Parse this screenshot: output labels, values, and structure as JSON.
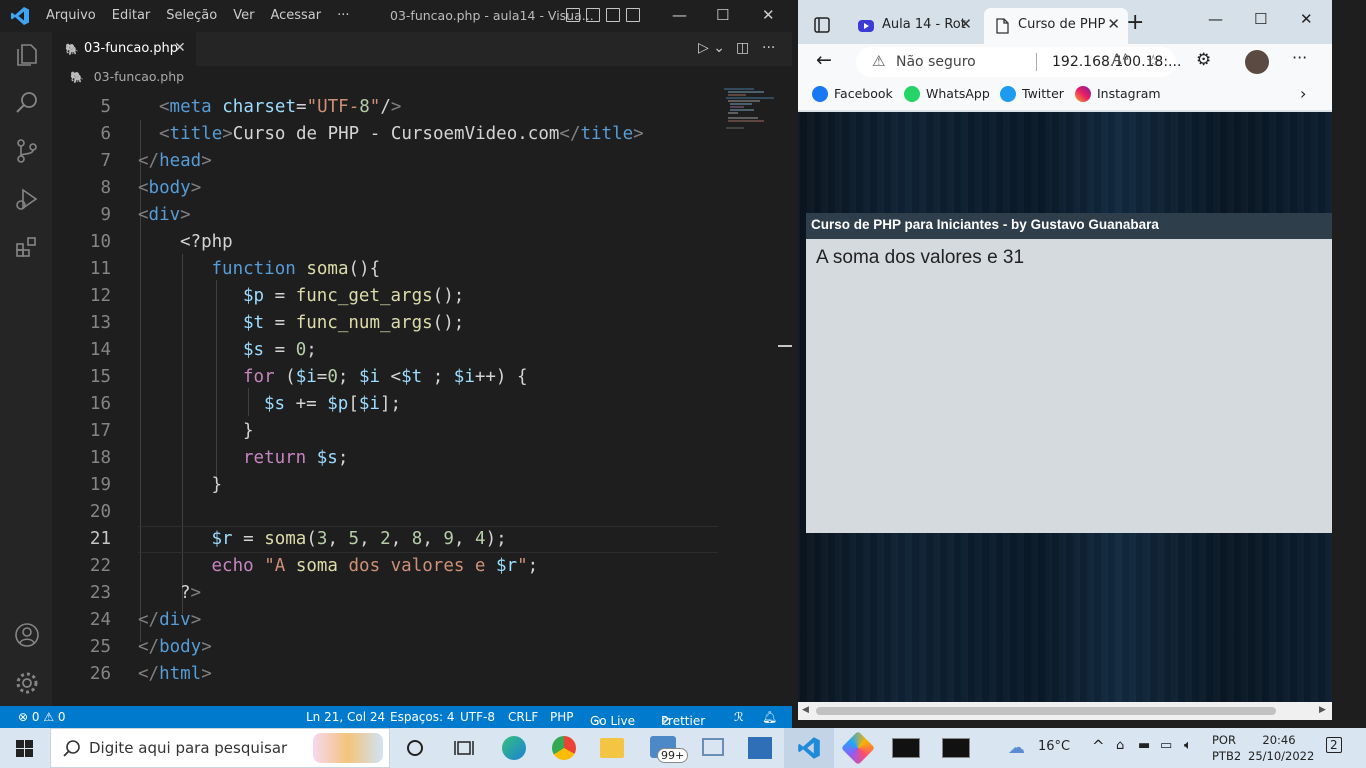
{
  "vscode": {
    "menu": [
      "Arquivo",
      "Editar",
      "Seleção",
      "Ver",
      "Acessar",
      "···"
    ],
    "window_title": "03-funcao.php - aula14 - Visua...",
    "tab_label": "03-funcao.php",
    "breadcrumb": "03-funcao.php",
    "code_lines": [
      {
        "n": "5",
        "text": "<meta charset=\"UTF-8\"/>"
      },
      {
        "n": "6",
        "text": "<title>Curso de PHP - CursoemVideo.com</title>"
      },
      {
        "n": "7",
        "text": "</head>"
      },
      {
        "n": "8",
        "text": "<body>"
      },
      {
        "n": "9",
        "text": "<div>"
      },
      {
        "n": "10",
        "text": "<?php"
      },
      {
        "n": "11",
        "text": "function soma(){"
      },
      {
        "n": "12",
        "text": "$p = func_get_args();"
      },
      {
        "n": "13",
        "text": "$t = func_num_args();"
      },
      {
        "n": "14",
        "text": "$s = 0;"
      },
      {
        "n": "15",
        "text": "for ($i=0; $i <$t ; $i++) {"
      },
      {
        "n": "16",
        "text": "$s += $p[$i];"
      },
      {
        "n": "17",
        "text": "}"
      },
      {
        "n": "18",
        "text": "return $s;"
      },
      {
        "n": "19",
        "text": "}"
      },
      {
        "n": "20",
        "text": ""
      },
      {
        "n": "21",
        "text": "$r = soma(3, 5, 2, 8, 9, 4);"
      },
      {
        "n": "22",
        "text": "echo \"A soma dos valores e $r\";"
      },
      {
        "n": "23",
        "text": "?>"
      },
      {
        "n": "24",
        "text": "</div>"
      },
      {
        "n": "25",
        "text": "</body>"
      },
      {
        "n": "26",
        "text": "</html>"
      }
    ],
    "status": {
      "problems": "0",
      "warnings": "0",
      "position": "Ln 21, Col 24",
      "spaces": "Espaços: 4",
      "encoding": "UTF-8",
      "eol": "CRLF",
      "language": "PHP",
      "golive": "Go Live",
      "prettier": "Prettier"
    }
  },
  "edge": {
    "tab1": "Aula 14 - Rot",
    "tab2": "Curso de PHP",
    "not_secure": "Não seguro",
    "url": "192.168.100.18:...",
    "favorites": [
      "Facebook",
      "WhatsApp",
      "Twitter",
      "Instagram"
    ],
    "page_header": "Curso de PHP para Iniciantes - by Gustavo Guanabara",
    "page_output": "A soma dos valores e 31"
  },
  "taskbar": {
    "search_placeholder": "Digite aqui para pesquisar",
    "mail_badge": "99+",
    "weather": "16°C",
    "lang1": "POR",
    "lang2": "PTB2",
    "time": "20:46",
    "date": "25/10/2022",
    "notifications": "2"
  },
  "colors": {
    "vscode_bg": "#1e1e1e",
    "statusbar": "#007acc",
    "keyword": "#569cd6",
    "function": "#dcdcaa",
    "string": "#ce9178",
    "variable": "#9cdcfe",
    "control": "#c586c0",
    "number": "#b5cea8",
    "page_header_bg": "#2f3e4b",
    "page_body_bg": "#d5dadf"
  }
}
